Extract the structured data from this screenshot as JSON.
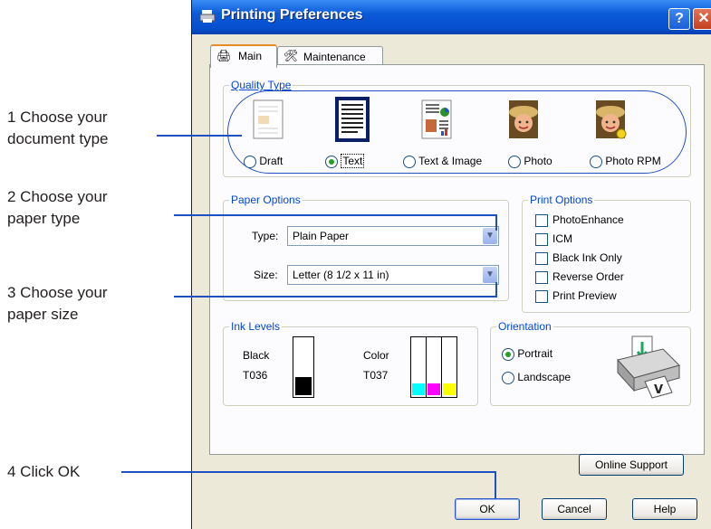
{
  "callouts": [
    {
      "line1": "1 Choose your",
      "line2": "document type"
    },
    {
      "line1": "2 Choose your",
      "line2": "paper type"
    },
    {
      "line1": "3 Choose your",
      "line2": "paper size"
    },
    {
      "line1": "4 Click OK",
      "line2": ""
    }
  ],
  "window": {
    "title": "Printing Preferences",
    "help_glyph": "?",
    "close_glyph": "✕"
  },
  "tabs": [
    {
      "label": "Main",
      "icon": "printer-icon"
    },
    {
      "label": "Maintenance",
      "icon": "printer-tools-icon"
    }
  ],
  "quality": {
    "label": "Quality Type",
    "options": [
      {
        "label": "Draft",
        "selected": false
      },
      {
        "label": "Text",
        "selected": true
      },
      {
        "label": "Text & Image",
        "selected": false
      },
      {
        "label": "Photo",
        "selected": false
      },
      {
        "label": "Photo RPM",
        "selected": false
      }
    ]
  },
  "paper": {
    "label": "Paper Options",
    "type_label": "Type:",
    "type_value": "Plain Paper",
    "size_label": "Size:",
    "size_value": "Letter (8 1/2 x 11 in)"
  },
  "print_options": {
    "label": "Print Options",
    "items": [
      "PhotoEnhance",
      "ICM",
      "Black Ink Only",
      "Reverse Order",
      "Print Preview"
    ]
  },
  "ink": {
    "label": "Ink Levels",
    "black_name": "Black",
    "black_code": "T036",
    "color_name": "Color",
    "color_code": "T037",
    "black_level": 0.35,
    "color_levels": [
      0.35,
      0.35,
      0.35
    ],
    "colors": {
      "cyan": "#00ffff",
      "magenta": "#ff00ff",
      "yellow": "#ffff00"
    }
  },
  "orientation": {
    "label": "Orientation",
    "portrait": "Portrait",
    "landscape": "Landscape",
    "selected": "Portrait"
  },
  "buttons": {
    "online_support": "Online Support",
    "ok": "OK",
    "cancel": "Cancel",
    "help": "Help"
  },
  "colors": {
    "accent": "#0046d5",
    "callout_line": "#1f4fc1",
    "titlebar": "#0a5ad8"
  }
}
